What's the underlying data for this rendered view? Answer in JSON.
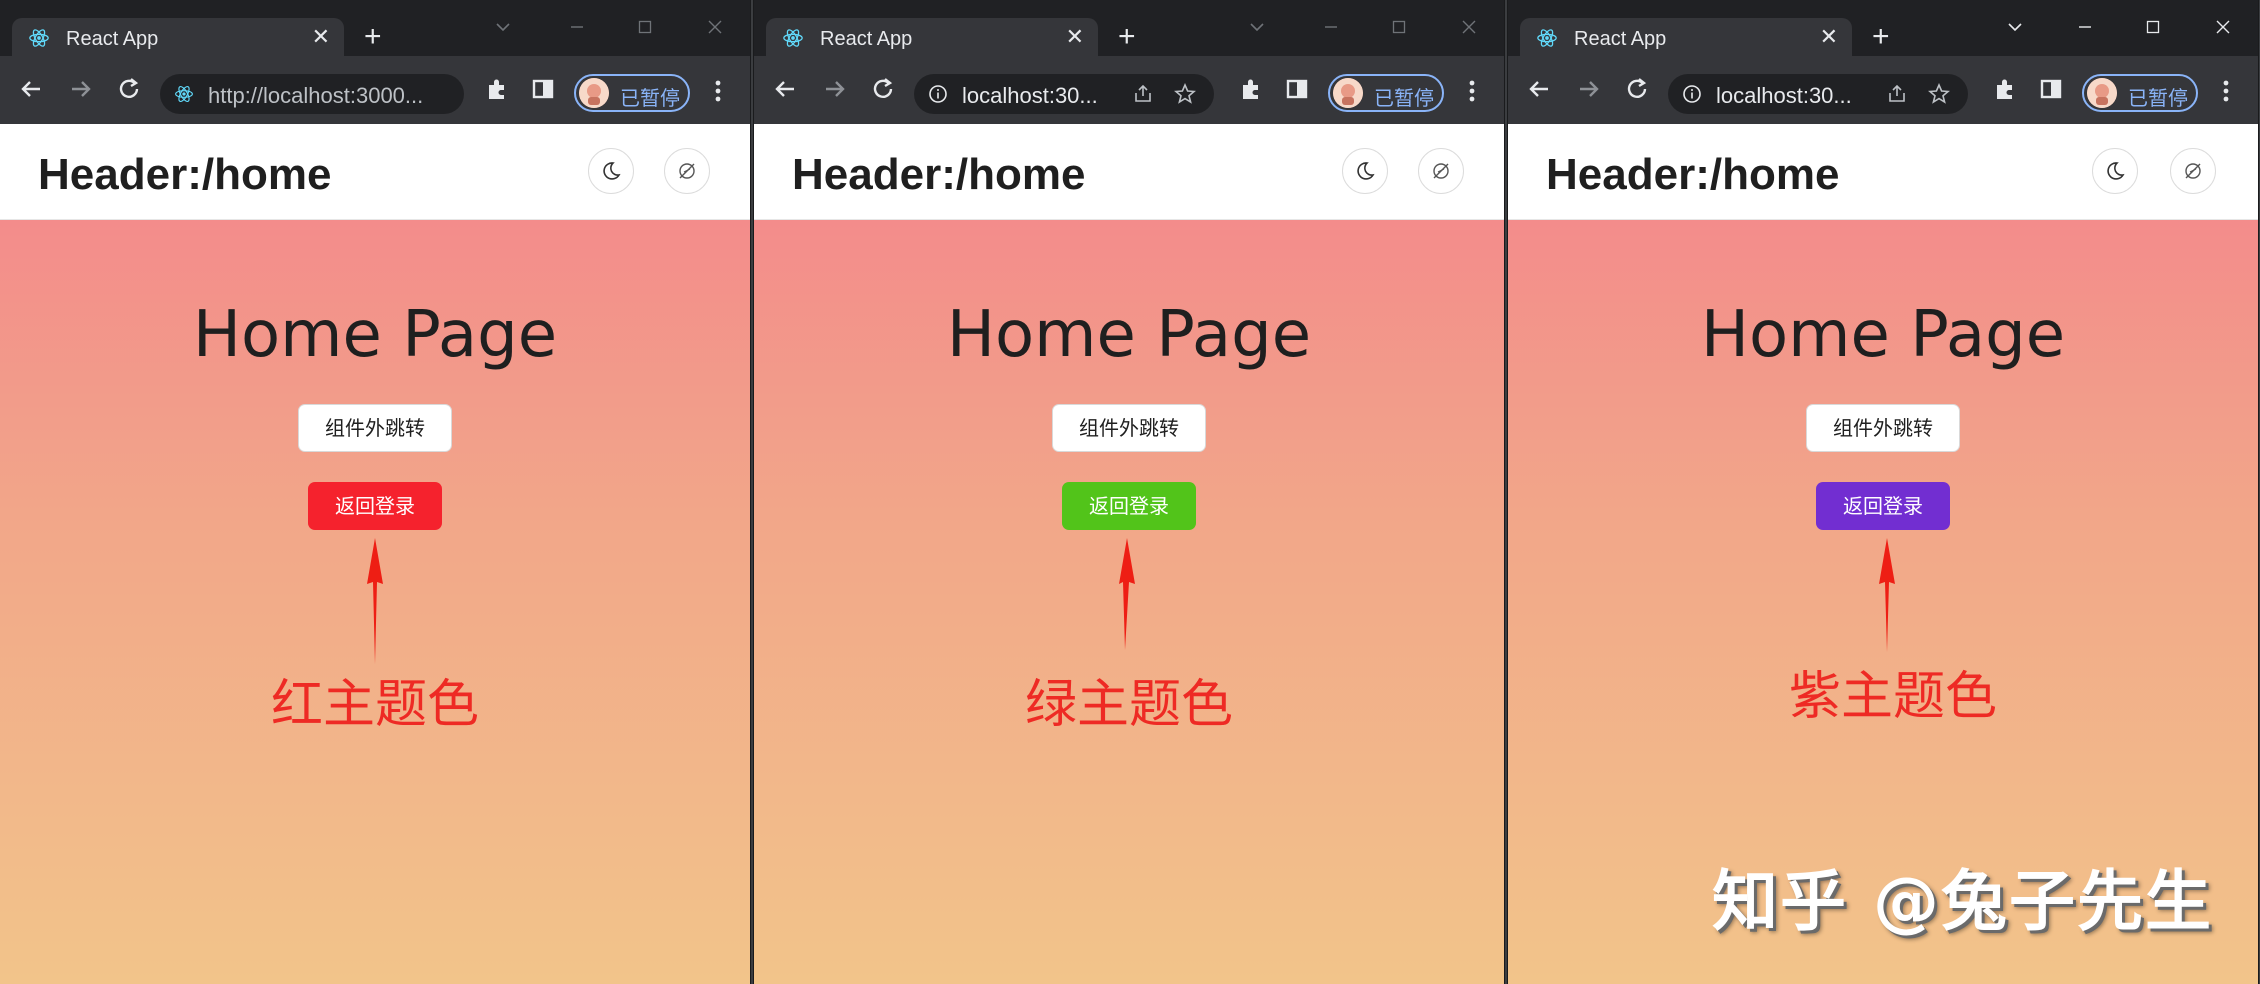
{
  "windows": [
    {
      "tab_title": "React App",
      "url": "http://localhost:3000...",
      "profile_label": "已暂停",
      "header_title": "Header:/home",
      "page_title": "Home Page",
      "outline_button_label": "组件外跳转",
      "primary_button_label": "返回登录",
      "primary_color": "#f5222d",
      "annotation": "红主题色"
    },
    {
      "tab_title": "React App",
      "url": "localhost:30...",
      "profile_label": "已暂停",
      "header_title": "Header:/home",
      "page_title": "Home Page",
      "outline_button_label": "组件外跳转",
      "primary_button_label": "返回登录",
      "primary_color": "#52c41a",
      "annotation": "绿主题色"
    },
    {
      "tab_title": "React App",
      "url": "localhost:30...",
      "profile_label": "已暂停",
      "header_title": "Header:/home",
      "page_title": "Home Page",
      "outline_button_label": "组件外跳转",
      "primary_button_label": "返回登录",
      "primary_color": "#722ed1",
      "annotation": "紫主题色"
    }
  ],
  "watermark": "知乎 @兔子先生",
  "icons": {
    "tab_favicon": "react-icon",
    "header_buttons": [
      "moon-icon",
      "eye-off-icon"
    ],
    "toolbar": [
      "back-icon",
      "forward-icon",
      "reload-icon",
      "info-icon",
      "extensions-icon",
      "sidepanel-icon",
      "menu-icon"
    ]
  }
}
